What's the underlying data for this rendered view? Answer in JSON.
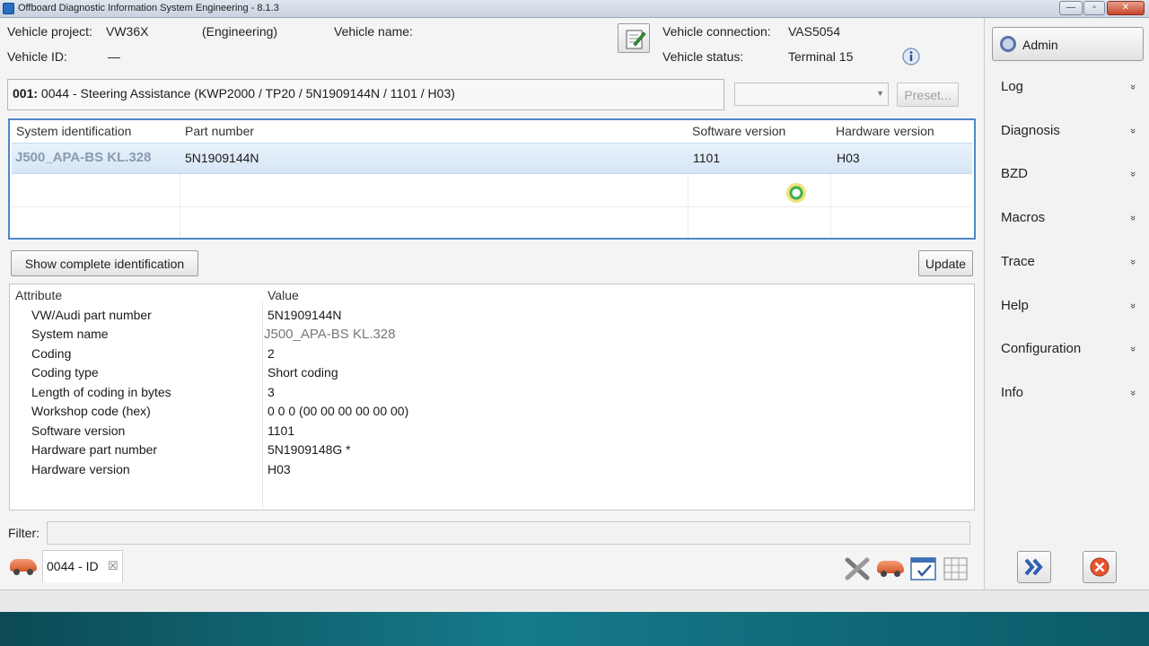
{
  "window": {
    "title": "Offboard Diagnostic Information System Engineering - 8.1.3",
    "controls": [
      "—",
      "▫",
      "✕"
    ]
  },
  "vehicle": {
    "project_label": "Vehicle project:",
    "project_value": "VW36X",
    "mode": "(Engineering)",
    "name_label": "Vehicle name:",
    "name_value": "",
    "id_label": "Vehicle ID:",
    "id_value": "—",
    "connection_label": "Vehicle connection:",
    "connection_value": "VAS5054",
    "status_label": "Vehicle status:",
    "status_value": "Terminal 15"
  },
  "ecu": {
    "address": "001:",
    "description": " 0044 - Steering Assistance  (KWP2000 / TP20 / 5N1909144N / 1101 / H03)"
  },
  "preset_select": {
    "value": ""
  },
  "buttons": {
    "preset": "Preset...",
    "show_complete": "Show complete identification",
    "update": "Update"
  },
  "system_table": {
    "headers": [
      "System identification",
      "Part number",
      "Software version",
      "Hardware version"
    ],
    "rows": [
      [
        "J500_APA-BS KL.328",
        "5N1909144N",
        "1101",
        "H03"
      ]
    ]
  },
  "attribute_table": {
    "headers": [
      "Attribute",
      "Value"
    ],
    "rows": [
      {
        "attribute": "VW/Audi part number",
        "value": "5N1909144N"
      },
      {
        "attribute": "System name",
        "value": "J500_APA-BS KL.328"
      },
      {
        "attribute": "Coding",
        "value": "2"
      },
      {
        "attribute": "Coding type",
        "value": "Short coding"
      },
      {
        "attribute": "Length of coding in bytes",
        "value": "3"
      },
      {
        "attribute": "Workshop code (hex)",
        "value": "0 0 0 (00 00 00 00 00 00)"
      },
      {
        "attribute": "Software version",
        "value": "1101"
      },
      {
        "attribute": "Hardware part number",
        "value": "5N1909148G  *"
      },
      {
        "attribute": "Hardware version",
        "value": "H03"
      }
    ]
  },
  "filter": {
    "label": "Filter:",
    "value": ""
  },
  "tabs": [
    {
      "label": "0044 - ID",
      "close": "☒"
    }
  ],
  "right_panel": {
    "admin": "Admin",
    "menu": [
      "Log",
      "Diagnosis",
      "BZD",
      "Macros",
      "Trace",
      "Help",
      "Configuration",
      "Info"
    ],
    "chevron": "»"
  },
  "icons": {
    "accent": "#4f88c6",
    "car": "car-icon",
    "edit": "edit-notepad-icon",
    "info": "info-icon"
  }
}
